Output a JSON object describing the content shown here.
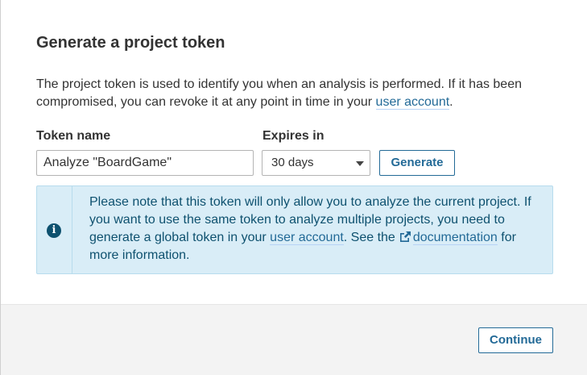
{
  "dialog": {
    "title": "Generate a project token",
    "description_prefix": "The project token is used to identify you when an analysis is performed. If it has been compromised, you can revoke it at any point in time in your",
    "description_link": "user account",
    "description_suffix": "."
  },
  "form": {
    "token_name_label": "Token name",
    "token_name_value": "Analyze \"BoardGame\"",
    "expires_label": "Expires in",
    "expires_value": "30 days",
    "generate_label": "Generate"
  },
  "info": {
    "text_part1": "Please note that this token will only allow you to analyze the current project. If you want to use the same token to analyze multiple projects, you need to generate a global token in your",
    "link_user_account": "user account",
    "text_part2": ". See the",
    "link_documentation": "documentation",
    "text_part3": "for more information.",
    "icon": "info-icon",
    "external_icon": "external-link-icon"
  },
  "footer": {
    "continue_label": "Continue"
  },
  "colors": {
    "accent": "#236a97",
    "info_bg": "#d9edf7",
    "info_text": "#0e516f",
    "footer_bg": "#f3f3f3"
  }
}
